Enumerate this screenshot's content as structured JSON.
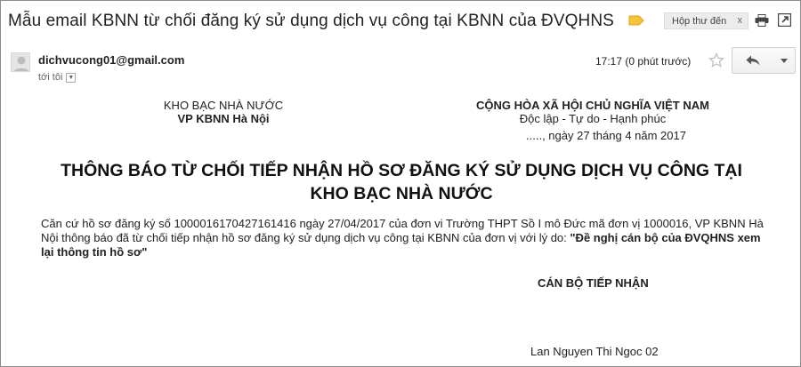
{
  "email": {
    "subject": "Mẫu email KBNN từ chối đăng ký sử dụng dịch vụ công tại KBNN của ĐVQHNS",
    "label_chip": "Hộp thư đến",
    "label_chip_close": "x",
    "sender": "dichvucong01@gmail.com",
    "to": "tới tôi",
    "time": "17:17 (0 phút trước)",
    "icons": {
      "label_marker": "label-icon",
      "print": "print-icon",
      "popout": "open-new-window-icon",
      "star": "star-icon",
      "reply": "reply-icon",
      "more": "chevron-down-icon"
    },
    "colors": {
      "label_marker": "#f6c33a"
    }
  },
  "letter": {
    "left_header": {
      "org": "KHO BẠC NHÀ NƯỚC",
      "unit": "VP KBNN Hà Nội"
    },
    "right_header": {
      "country": "CỘNG HÒA XÃ HỘI CHỦ NGHĨA VIỆT NAM",
      "motto": "Độc lập - Tự do - Hạnh phúc",
      "date": "....., ngày 27 tháng 4 năm 2017"
    },
    "title_line1": "THÔNG BÁO TỪ CHỐI TIẾP NHẬN HỒ SƠ ĐĂNG KÝ SỬ DỤNG DỊCH VỤ CÔNG TẠI",
    "title_line2": "KHO BẠC NHÀ NƯỚC",
    "body_line1": "Căn cứ hồ sơ đăng ký số 1000016170427161416 ngày 27/04/2017 của đơn vi Trường THPT Sồ I mô Đức mã đơn vị 1000016, VP KBNN Hà",
    "body_line2_plain": "Nội thông báo đã từ chối tiếp nhận hồ sơ đăng ký sử dụng dịch vụ công tại KBNN của đơn vị với lý do: ",
    "body_line2_bold": "\"Đề nghị cán bộ của ĐVQHNS xem",
    "body_line3_bold": "lại thông tin hồ sơ\"",
    "signer_title": "CÁN BỘ TIẾP NHẬN",
    "signer_name": "Lan Nguyen Thi Ngoc 02"
  }
}
